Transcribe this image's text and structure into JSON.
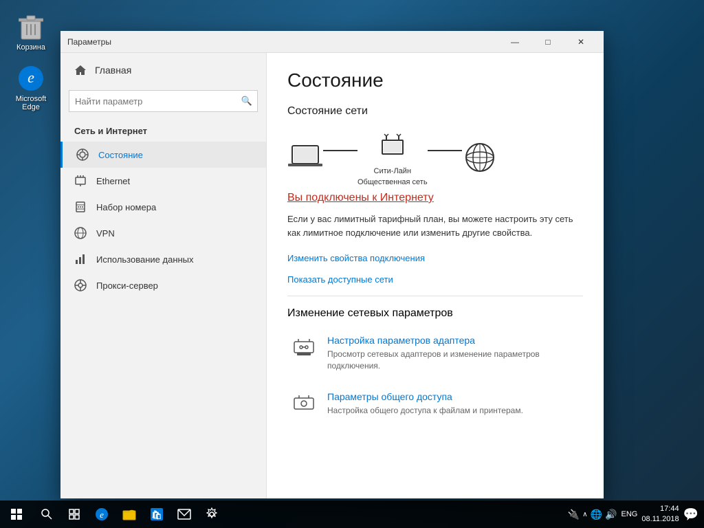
{
  "desktop": {
    "icons": [
      {
        "id": "recycle-bin",
        "label": "Корзина"
      },
      {
        "id": "edge",
        "label": "Microsoft\nEdge"
      }
    ]
  },
  "taskbar": {
    "clock": {
      "time": "17:44",
      "date": "08.11.2018"
    },
    "lang": "ENG"
  },
  "window": {
    "title": "Параметры",
    "controls": {
      "minimize": "—",
      "maximize": "□",
      "close": "✕"
    }
  },
  "sidebar": {
    "home_label": "Главная",
    "search_placeholder": "Найти параметр",
    "section_title": "Сеть и Интернет",
    "nav_items": [
      {
        "id": "status",
        "label": "Состояние",
        "active": true
      },
      {
        "id": "ethernet",
        "label": "Ethernet"
      },
      {
        "id": "dialup",
        "label": "Набор номера"
      },
      {
        "id": "vpn",
        "label": "VPN"
      },
      {
        "id": "data-usage",
        "label": "Использование данных"
      },
      {
        "id": "proxy",
        "label": "Прокси-сервер"
      }
    ]
  },
  "main": {
    "page_title": "Состояние",
    "network_status_title": "Состояние сети",
    "network_name": "Сити-Лайн",
    "network_type": "Общественная сеть",
    "connected_text": "Вы подключены к Интернету",
    "info_text": "Если у вас лимитный тарифный план, вы можете настроить эту сеть как лимитное подключение или изменить другие свойства.",
    "link_properties": "Изменить свойства подключения",
    "link_networks": "Показать доступные сети",
    "change_settings_title": "Изменение сетевых параметров",
    "settings_items": [
      {
        "id": "adapter",
        "title": "Настройка параметров адаптера",
        "desc": "Просмотр сетевых адаптеров и изменение параметров подключения."
      },
      {
        "id": "sharing",
        "title": "Параметры общего доступа",
        "desc": "Настройка общего доступа к файлам и принтерам."
      }
    ]
  }
}
